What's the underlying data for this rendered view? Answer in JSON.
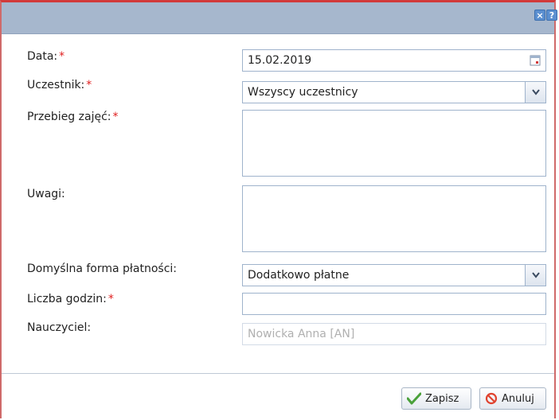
{
  "dialog": {
    "titlebar": {
      "close_icon": "close-icon",
      "help_icon": "help-icon",
      "close_glyph": "×",
      "help_glyph": "?"
    },
    "required_marker": "*",
    "fields": {
      "date": {
        "label": "Data:",
        "value": "15.02.2019",
        "required": true,
        "icon": "calendar-icon"
      },
      "participant": {
        "label": "Uczestnik:",
        "value": "Wszyscy uczestnicy",
        "required": true,
        "icon": "chevron-down-icon"
      },
      "course": {
        "label": "Przebieg zajęć:",
        "value": "",
        "required": true
      },
      "notes": {
        "label": "Uwagi:",
        "value": "",
        "required": false
      },
      "payment": {
        "label": "Domyślna forma płatności:",
        "value": "Dodatkowo płatne",
        "required": false,
        "icon": "chevron-down-icon"
      },
      "hours": {
        "label": "Liczba godzin:",
        "value": "",
        "required": true
      },
      "teacher": {
        "label": "Nauczyciel:",
        "value": "Nowicka Anna [AN]",
        "required": false
      }
    },
    "footer": {
      "save_label": "Zapisz",
      "cancel_label": "Anuluj"
    },
    "colors": {
      "titlebar": "#a6b7cd",
      "required": "#e02020",
      "border_accent": "#d23a3a",
      "save_icon": "#4aa13a",
      "cancel_icon": "#e0432f"
    }
  }
}
